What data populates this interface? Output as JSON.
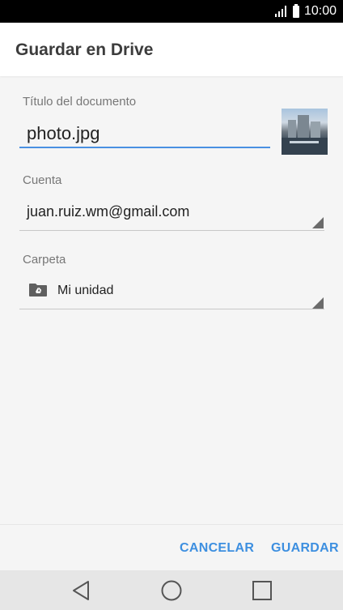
{
  "status_bar": {
    "time": "10:00",
    "icons": [
      "signal-icon",
      "battery-icon"
    ]
  },
  "header": {
    "title": "Guardar en Drive"
  },
  "form": {
    "title_label": "Título del documento",
    "title_value": "photo.jpg",
    "account_label": "Cuenta",
    "account_value": "juan.ruiz.wm@gmail.com",
    "folder_label": "Carpeta",
    "folder_value": "Mi unidad"
  },
  "actions": {
    "cancel_label": "CANCELAR",
    "save_label": "GUARDAR"
  },
  "navigation": {
    "buttons": [
      "back-icon",
      "home-icon",
      "recents-icon"
    ]
  },
  "colors": {
    "accent": "#3d8fe0",
    "field_underline_active": "#4a90e2",
    "status_bar": "#000000",
    "nav_bar": "#e6e6e6"
  }
}
